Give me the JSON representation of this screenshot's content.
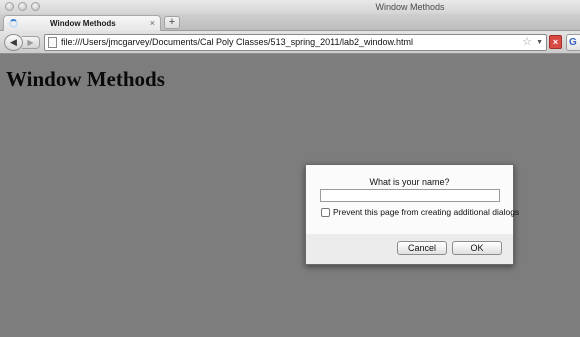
{
  "window": {
    "title": "Window Methods"
  },
  "tabs": [
    {
      "label": "Window Methods",
      "close": "×"
    }
  ],
  "toolbar": {
    "new_tab": "+",
    "back": "◀",
    "forward": "▶"
  },
  "address_bar": {
    "url": "file:///Users/jmcgarvey/Documents/Cal Poly Classes/513_spring_2011/lab2_window.html",
    "star": "☆",
    "dropdown": "▼"
  },
  "stop_button": {
    "label": "×"
  },
  "search_engine": {
    "label": "G"
  },
  "page": {
    "heading": "Window Methods"
  },
  "dialog": {
    "prompt": "What is your name?",
    "input_value": "",
    "checkbox_label": "Prevent this page from creating additional dialogs",
    "checkbox_checked": false,
    "cancel_label": "Cancel",
    "ok_label": "OK"
  },
  "colors": {
    "page_overlay": "#7d7d7d",
    "stop": "#d84b45",
    "spinner": "#3b7fd1"
  }
}
